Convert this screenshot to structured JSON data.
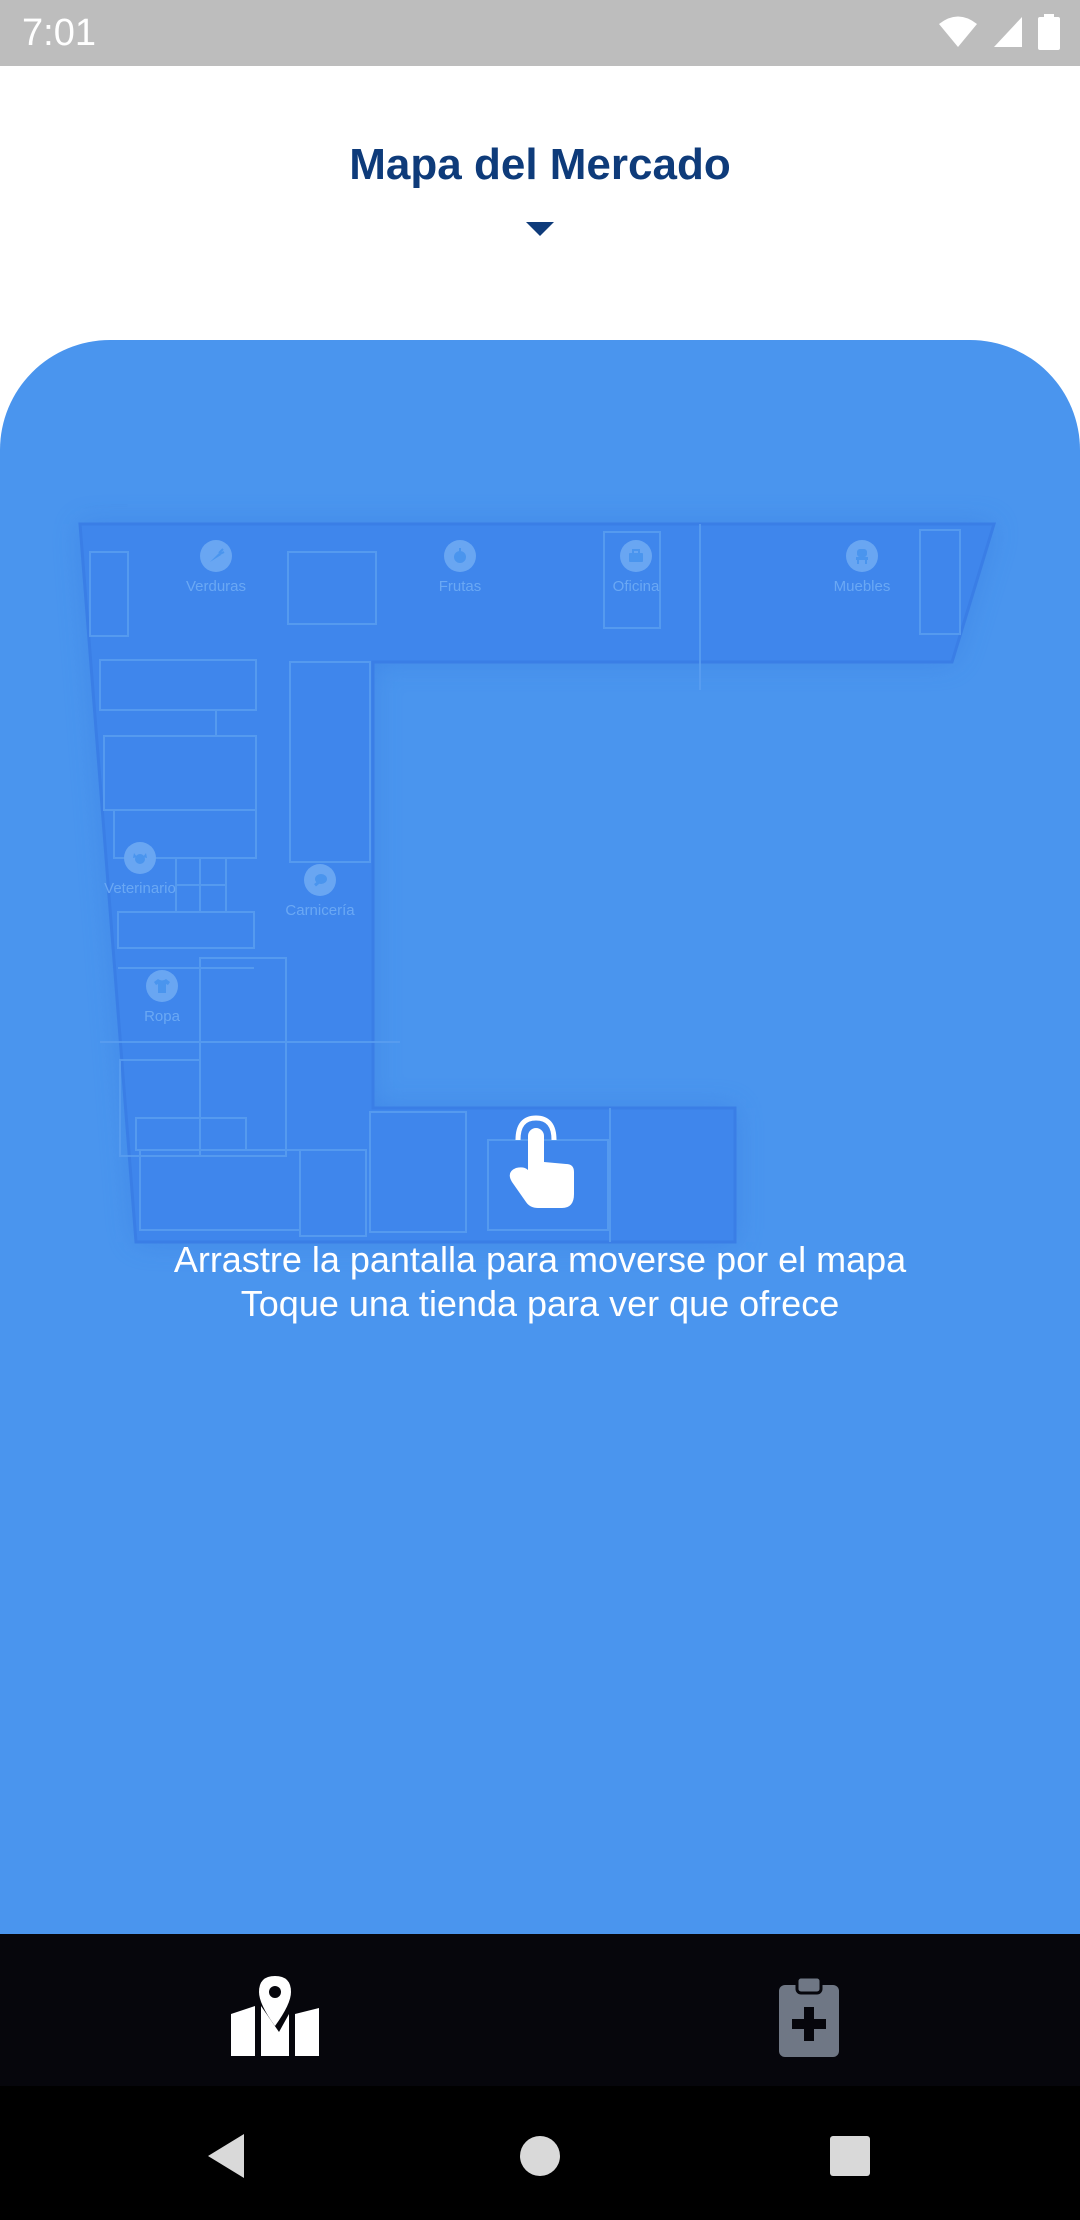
{
  "status_bar": {
    "time": "7:01",
    "icons": [
      "wifi-icon",
      "cell-signal-icon",
      "battery-icon"
    ]
  },
  "header": {
    "title": "Mapa del Mercado"
  },
  "map": {
    "stores": [
      {
        "name": "Verduras",
        "icon": "carrot-icon"
      },
      {
        "name": "Frutas",
        "icon": "apple-icon"
      },
      {
        "name": "Oficina",
        "icon": "briefcase-icon"
      },
      {
        "name": "Muebles",
        "icon": "chair-icon"
      },
      {
        "name": "Veterinario",
        "icon": "dog-icon"
      },
      {
        "name": "Carnicería",
        "icon": "meat-icon"
      },
      {
        "name": "Ropa",
        "icon": "shirt-icon"
      }
    ],
    "hint_line1": "Arrastre la pantalla para moverse por el mapa",
    "hint_line2": "Toque una tienda para ver que ofrece"
  },
  "bottom_nav": {
    "items": [
      {
        "icon": "map-icon",
        "active": true
      },
      {
        "icon": "clipboard-add-icon",
        "active": false
      }
    ]
  },
  "colors": {
    "panel": "#4a95ee",
    "title": "#0e3b7a",
    "nav_bg": "#06060c"
  }
}
